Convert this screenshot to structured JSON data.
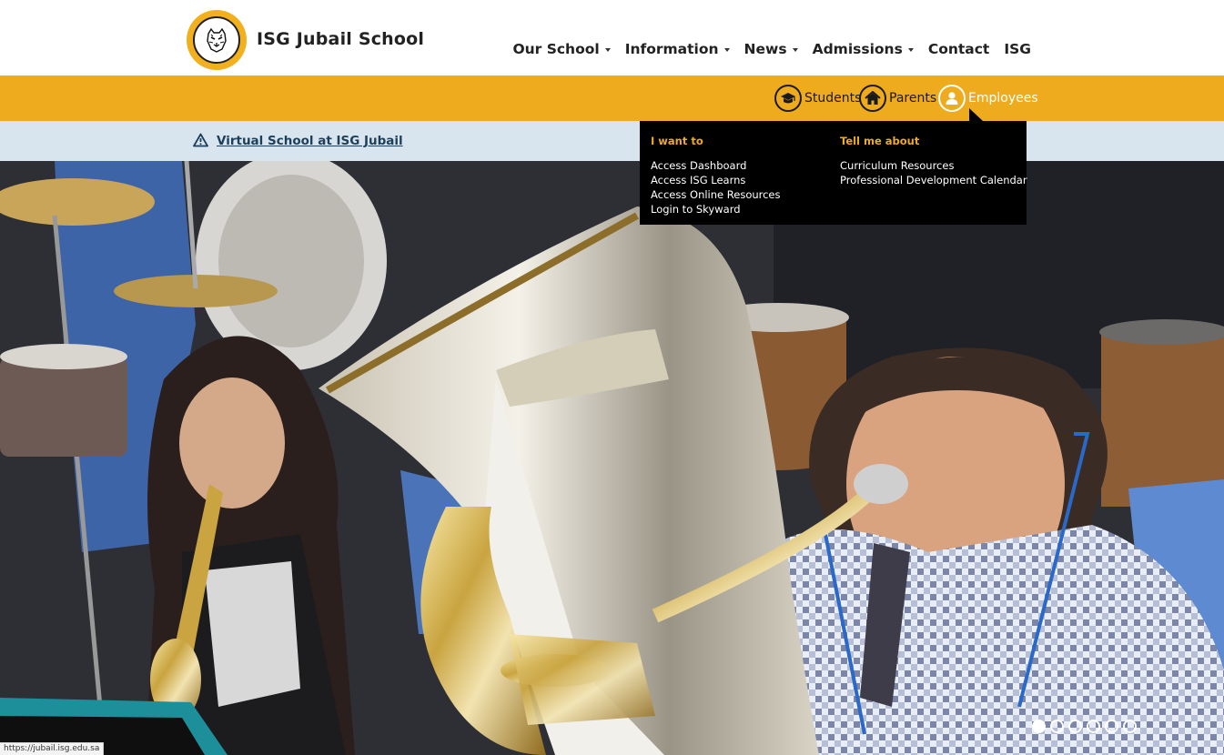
{
  "site": {
    "title": "ISG Jubail School"
  },
  "main_nav": [
    {
      "label": "Our School",
      "has_caret": true
    },
    {
      "label": "Information",
      "has_caret": true
    },
    {
      "label": "News",
      "has_caret": true
    },
    {
      "label": "Admissions",
      "has_caret": true
    },
    {
      "label": "Contact",
      "has_caret": false
    },
    {
      "label": "ISG",
      "has_caret": false
    }
  ],
  "audience": {
    "students": {
      "label": "Students",
      "icon": "graduation-cap-icon"
    },
    "parents": {
      "label": "Parents",
      "icon": "home-icon"
    },
    "employees": {
      "label": "Employees",
      "icon": "user-icon",
      "active": true
    }
  },
  "alert": {
    "icon": "warning-triangle-icon",
    "link_text": "Virtual School at ISG Jubail"
  },
  "dropdown": {
    "left_heading": "I want to",
    "left_links": [
      "Access Dashboard",
      "Access ISG Learns",
      "Access Online Resources",
      "Login to Skyward"
    ],
    "right_heading": "Tell me about",
    "right_links": [
      "Curriculum Resources",
      "Professional Development Calendar"
    ]
  },
  "carousel": {
    "slide_count": 6,
    "active_index": 0
  },
  "status_bar": {
    "url": "https://jubail.isg.edu.sa"
  },
  "colors": {
    "accent_yellow": "#eeab1d",
    "alert_bg": "#d8e4ee",
    "alert_link": "#1d3f5a",
    "dropdown_bg": "#000000"
  }
}
